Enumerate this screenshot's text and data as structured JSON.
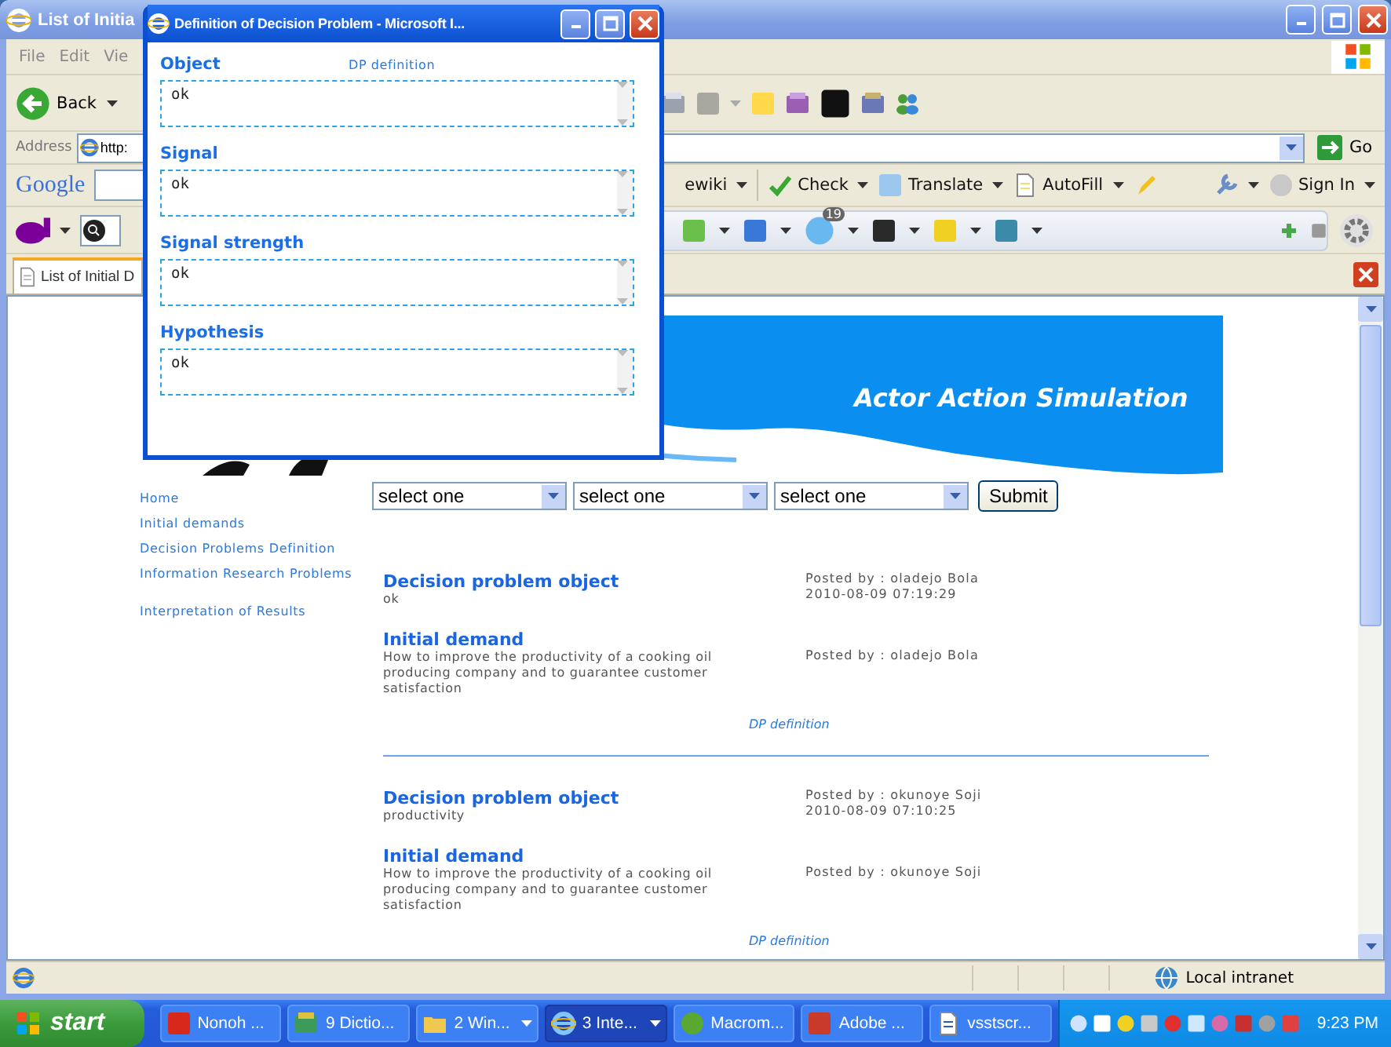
{
  "browser": {
    "title": "List of Initia",
    "menu": [
      "File",
      "Edit",
      "Vie"
    ],
    "back_label": "Back",
    "address_label": "Address",
    "address_value": "http:",
    "go_label": "Go",
    "google_toolbar": {
      "logo": "Google",
      "items": [
        {
          "label": "ewiki"
        },
        {
          "label": "Check"
        },
        {
          "label": "Translate"
        },
        {
          "label": "AutoFill"
        }
      ],
      "sign_in": "Sign In"
    },
    "yahoo_toolbar": {
      "weather_badge": "19"
    },
    "tab": {
      "label": "List of Initial D"
    },
    "status_bar": {
      "zone": "Local intranet"
    }
  },
  "page": {
    "banner_title": "Actor Action Simulation",
    "nav": [
      "Home",
      "Initial demands",
      "Decision Problems Definition",
      "Information Research Problems",
      "Interpretation of Results"
    ],
    "filters": [
      {
        "value": "select one"
      },
      {
        "value": "select one"
      },
      {
        "value": "select one"
      }
    ],
    "submit": "Submit",
    "posts": [
      {
        "object_heading": "Decision problem object",
        "object_value": "ok",
        "object_posted_by": "Posted by : oladejo Bola",
        "object_date": "2010-08-09 07:19:29",
        "demand_heading": "Initial demand",
        "demand_text": "How to improve the productivity of a cooking oil producing company and to guarantee customer satisfaction",
        "demand_posted_by": "Posted by : oladejo Bola",
        "link": "DP definition"
      },
      {
        "object_heading": "Decision problem object",
        "object_value": "productivity",
        "object_posted_by": "Posted by : okunoye Soji",
        "object_date": "2010-08-09 07:10:25",
        "demand_heading": "Initial demand",
        "demand_text": "How to improve the productivity of a cooking oil producing company and to guarantee customer satisfaction",
        "demand_posted_by": "Posted by : okunoye Soji",
        "link": "DP definition"
      }
    ]
  },
  "popup": {
    "title": "Definition of Decision Problem - Microsoft I...",
    "link": "DP definition",
    "fields": [
      {
        "label": "Object",
        "value": "ok"
      },
      {
        "label": "Signal",
        "value": "ok"
      },
      {
        "label": "Signal strength",
        "value": "ok"
      },
      {
        "label": "Hypothesis",
        "value": "ok"
      }
    ]
  },
  "taskbar": {
    "start": "start",
    "tasks": [
      {
        "label": "Nonoh ...",
        "selected": false,
        "has_menu": false
      },
      {
        "label": "9 Dictio...",
        "selected": false,
        "has_menu": false
      },
      {
        "label": "2 Win...",
        "selected": false,
        "has_menu": true
      },
      {
        "label": "3 Inte...",
        "selected": true,
        "has_menu": true
      },
      {
        "label": "Macrom...",
        "selected": false,
        "has_menu": false
      },
      {
        "label": "Adobe ...",
        "selected": false,
        "has_menu": false
      },
      {
        "label": "vsstscr...",
        "selected": false,
        "has_menu": false
      }
    ],
    "clock": "9:23 PM"
  }
}
